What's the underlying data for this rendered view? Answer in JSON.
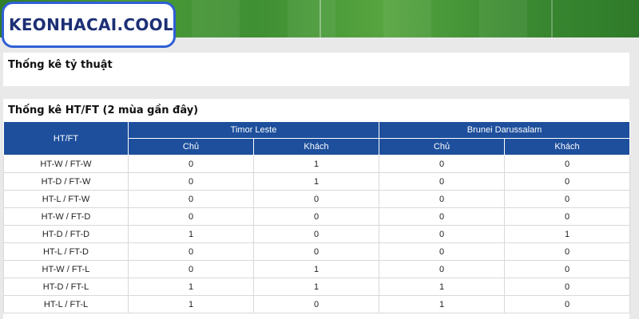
{
  "brand": {
    "name": "KEONHACAI.COOL",
    "accent": "#2f5fd6",
    "text_color": "#1c2f75"
  },
  "section_odds": {
    "title": "Thống kê tỷ thuật"
  },
  "section_htft": {
    "title": "Thống kê HT/FT (2 mùa gần đây)",
    "header_color": "#1d4f9c",
    "corner_label": "HT/FT",
    "teams": [
      {
        "name": "Timor Leste",
        "sub": [
          "Chủ",
          "Khách"
        ]
      },
      {
        "name": "Brunei Darussalam",
        "sub": [
          "Chủ",
          "Khách"
        ]
      }
    ],
    "rows": [
      {
        "label": "HT-W / FT-W",
        "values": [
          "0",
          "1",
          "0",
          "0"
        ]
      },
      {
        "label": "HT-D / FT-W",
        "values": [
          "0",
          "1",
          "0",
          "0"
        ]
      },
      {
        "label": "HT-L / FT-W",
        "values": [
          "0",
          "0",
          "0",
          "0"
        ]
      },
      {
        "label": "HT-W / FT-D",
        "values": [
          "0",
          "0",
          "0",
          "0"
        ]
      },
      {
        "label": "HT-D / FT-D",
        "values": [
          "1",
          "0",
          "0",
          "1"
        ]
      },
      {
        "label": "HT-L / FT-D",
        "values": [
          "0",
          "0",
          "0",
          "0"
        ]
      },
      {
        "label": "HT-W / FT-L",
        "values": [
          "0",
          "1",
          "0",
          "0"
        ]
      },
      {
        "label": "HT-D / FT-L",
        "values": [
          "1",
          "1",
          "1",
          "0"
        ]
      },
      {
        "label": "HT-L / FT-L",
        "values": [
          "1",
          "0",
          "1",
          "0"
        ]
      }
    ]
  }
}
